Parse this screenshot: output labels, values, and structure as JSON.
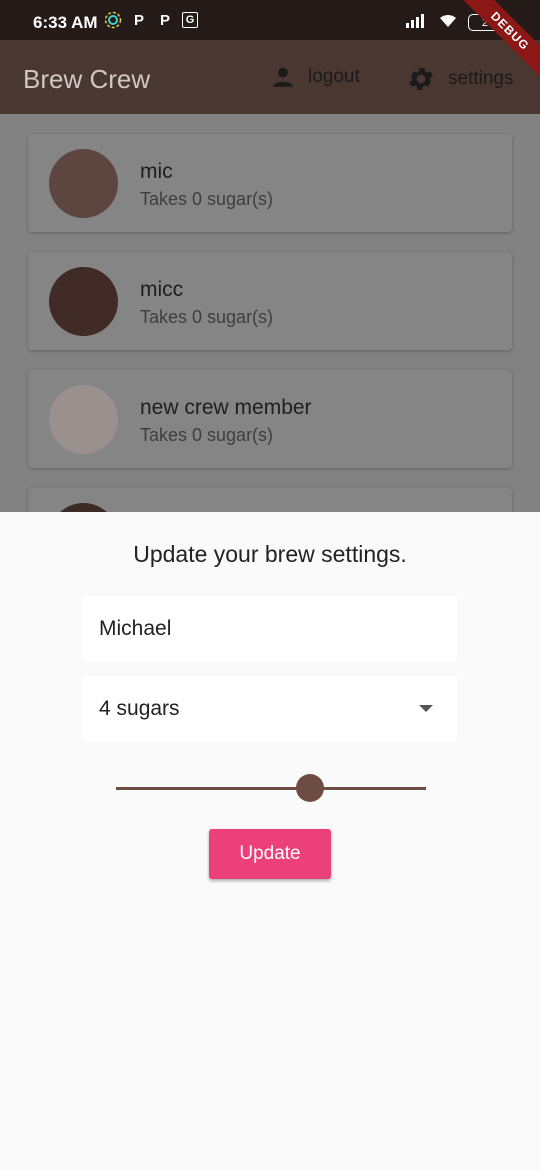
{
  "status_bar": {
    "time": "6:33 AM",
    "left_icons": [
      "settings-icon",
      "p-icon",
      "p-icon",
      "translate-icon"
    ],
    "p_glyph": "P",
    "translate_glyph": "G",
    "battery": "29"
  },
  "debug_banner": "DEBUG",
  "app_bar": {
    "title": "Brew Crew",
    "logout_label": "logout",
    "settings_label": "settings"
  },
  "brews": [
    {
      "name": "mic",
      "subtitle": "Takes 0 sugar(s)",
      "color": "#5e4640"
    },
    {
      "name": "micc",
      "subtitle": "Takes 0 sugar(s)",
      "color": "#402b26"
    },
    {
      "name": "new crew member",
      "subtitle": "Takes 0 sugar(s)",
      "color": "#9a918f"
    }
  ],
  "settings_form": {
    "title": "Update your brew settings.",
    "name_value": "Michael",
    "sugars_value": "4 sugars",
    "strength_level": 0.625,
    "update_label": "Update"
  },
  "colors": {
    "accent": "#ec407a",
    "brown": "#6d4c41",
    "appbar": "#4a3731"
  }
}
